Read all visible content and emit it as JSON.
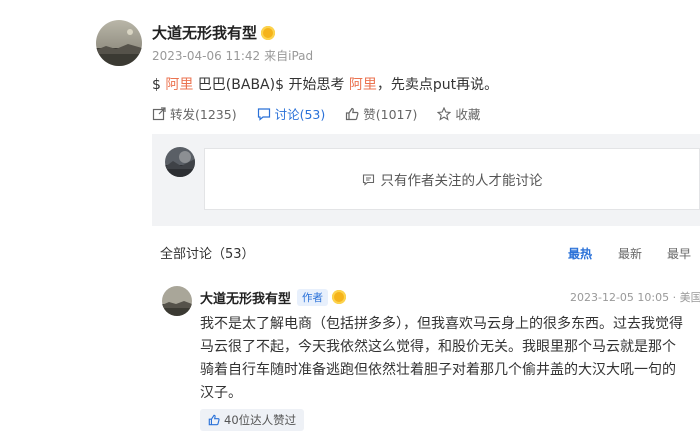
{
  "post": {
    "author": "大道无形我有型",
    "time": "2023-04-06 11:42",
    "source": "来自iPad",
    "text_prefix": "$ ",
    "text_link1": "阿里",
    "text_mid1": " 巴巴(BABA)$ 开始思考 ",
    "text_link2": "阿里",
    "text_suffix": "，先卖点put再说。"
  },
  "actions": {
    "repost": "转发(1235)",
    "comment": "讨论(53)",
    "like": "赞(1017)",
    "favorite": "收藏"
  },
  "notice": "只有作者关注的人才能讨论",
  "comments_header": "全部讨论（53）",
  "sort_options": [
    "最热",
    "最新",
    "最早"
  ],
  "comment": {
    "author": "大道无形我有型",
    "tag": "作者",
    "time": "2023-12-05 10:05 · 美国",
    "text": "我不是太了解电商（包括拼多多），但我喜欢马云身上的很多东西。过去我觉得马云很了不起，今天我依然这么觉得，和股价无关。我眼里那个马云就是那个骑着自行车随时准备逃跑但依然壮着胆子对着那几个偷井盖的大汉大吼一句的汉子。",
    "likes": "40位达人赞过"
  },
  "colors": {
    "accent": "#2a71d8",
    "link": "#eb7350",
    "badge": "#f5b31b"
  }
}
